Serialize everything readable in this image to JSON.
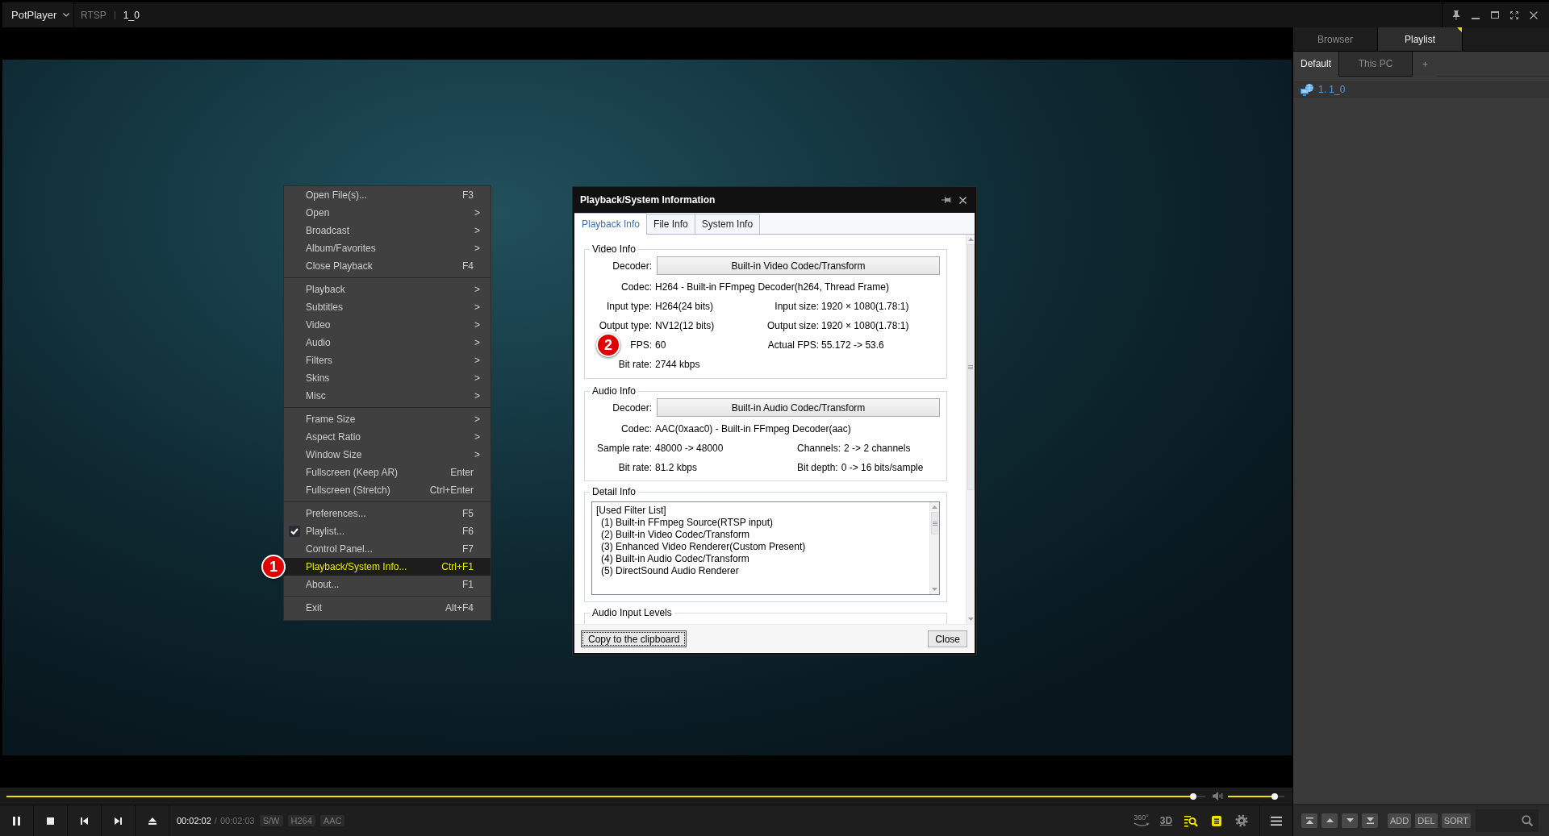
{
  "title_bar": {
    "app_name": "PotPlayer",
    "source": "RTSP",
    "title": "1_0"
  },
  "context_menu": {
    "groups": [
      [
        {
          "label": "Open File(s)...",
          "shortcut": "F3",
          "checked": false,
          "selected": false
        },
        {
          "label": "Open",
          "submenu": ">",
          "checked": false,
          "selected": false
        },
        {
          "label": "Broadcast",
          "submenu": ">",
          "checked": false,
          "selected": false
        },
        {
          "label": "Album/Favorites",
          "submenu": ">",
          "checked": false,
          "selected": false
        },
        {
          "label": "Close Playback",
          "shortcut": "F4",
          "checked": false,
          "selected": false
        }
      ],
      [
        {
          "label": "Playback",
          "submenu": ">",
          "checked": false,
          "selected": false
        },
        {
          "label": "Subtitles",
          "submenu": ">",
          "checked": false,
          "selected": false
        },
        {
          "label": "Video",
          "submenu": ">",
          "checked": false,
          "selected": false
        },
        {
          "label": "Audio",
          "submenu": ">",
          "checked": false,
          "selected": false
        },
        {
          "label": "Filters",
          "submenu": ">",
          "checked": false,
          "selected": false
        },
        {
          "label": "Skins",
          "submenu": ">",
          "checked": false,
          "selected": false
        },
        {
          "label": "Misc",
          "submenu": ">",
          "checked": false,
          "selected": false
        }
      ],
      [
        {
          "label": "Frame Size",
          "submenu": ">",
          "checked": false,
          "selected": false
        },
        {
          "label": "Aspect Ratio",
          "submenu": ">",
          "checked": false,
          "selected": false
        },
        {
          "label": "Window Size",
          "submenu": ">",
          "checked": false,
          "selected": false
        },
        {
          "label": "Fullscreen (Keep AR)",
          "shortcut": "Enter",
          "checked": false,
          "selected": false
        },
        {
          "label": "Fullscreen (Stretch)",
          "shortcut": "Ctrl+Enter",
          "checked": false,
          "selected": false
        }
      ],
      [
        {
          "label": "Preferences...",
          "shortcut": "F5",
          "checked": false,
          "selected": false
        },
        {
          "label": "Playlist...",
          "shortcut": "F6",
          "checked": true,
          "selected": false
        },
        {
          "label": "Control Panel...",
          "shortcut": "F7",
          "checked": false,
          "selected": false
        },
        {
          "label": "Playback/System Info...",
          "shortcut": "Ctrl+F1",
          "checked": false,
          "selected": true,
          "marker": "1"
        },
        {
          "label": "About...",
          "shortcut": "F1",
          "checked": false,
          "selected": false
        }
      ],
      [
        {
          "label": "Exit",
          "shortcut": "Alt+F4",
          "checked": false,
          "selected": false
        }
      ]
    ]
  },
  "info_dialog": {
    "title": "Playback/System Information",
    "tabs": [
      {
        "label": "Playback Info",
        "selected": true
      },
      {
        "label": "File Info",
        "selected": false
      },
      {
        "label": "System Info",
        "selected": false
      }
    ],
    "sections": [
      {
        "kind": "video",
        "legend": "Video Info",
        "decoder": {
          "label": "Decoder:",
          "value": "Built-in Video Codec/Transform"
        },
        "rows": [
          [
            {
              "label": "Codec:",
              "value": "H264 - Built-in FFmpeg Decoder(h264, Thread Frame)"
            }
          ],
          [
            {
              "label": "Input type:",
              "value": "H264(24 bits)"
            },
            {
              "label": "Input size:",
              "value": "1920 × 1080(1.78:1)"
            }
          ],
          [
            {
              "label": "Output type:",
              "value": "NV12(12 bits)"
            },
            {
              "label": "Output size:",
              "value": "1920 × 1080(1.78:1)"
            }
          ],
          [
            {
              "label": "FPS:",
              "value": "60",
              "marker": "2"
            },
            {
              "label": "Actual FPS:",
              "value": "55.172 -> 53.6"
            }
          ],
          [
            {
              "label": "Bit rate:",
              "value": "2744 kbps"
            }
          ]
        ]
      },
      {
        "kind": "audio",
        "legend": "Audio Info",
        "decoder": {
          "label": "Decoder:",
          "value": "Built-in Audio Codec/Transform"
        },
        "rows": [
          [
            {
              "label": "Codec:",
              "value": "AAC(0xaac0) - Built-in FFmpeg Decoder(aac)"
            }
          ],
          [
            {
              "label": "Sample rate:",
              "value": "48000 -> 48000"
            },
            {
              "label": "Channels:",
              "value": "2 -> 2 channels"
            }
          ],
          [
            {
              "label": "Bit rate:",
              "value": "81.2 kbps"
            },
            {
              "label": "Bit depth:",
              "value": "0 -> 16 bits/sample"
            }
          ]
        ]
      },
      {
        "kind": "detail",
        "legend": "Detail Info",
        "lines": [
          {
            "text": "[Used Filter List]",
            "children": [
              {
                "text": "(1) Built-in FFmpeg Source(RTSP input)"
              },
              {
                "text": "(2) Built-in Video Codec/Transform"
              },
              {
                "text": "(3) Enhanced Video Renderer(Custom Present)"
              },
              {
                "text": "(4) Built-in Audio Codec/Transform"
              },
              {
                "text": "(5) DirectSound Audio Renderer"
              }
            ]
          }
        ]
      },
      {
        "kind": "levels",
        "legend": "Audio Input Levels"
      }
    ],
    "buttons": [
      {
        "label": "Copy to the clipboard",
        "focused": true
      },
      {
        "label": "Close",
        "focused": false
      }
    ]
  },
  "playlist_panel": {
    "tabs": [
      {
        "label": "Browser",
        "selected": false
      },
      {
        "label": "Playlist",
        "selected": true
      }
    ],
    "lists": [
      {
        "label": "Default",
        "selected": true
      },
      {
        "label": "This PC",
        "selected": false
      }
    ],
    "new_list": "+",
    "items": [
      {
        "label": "1. 1_0",
        "playing": true
      }
    ],
    "actions": [
      "ADD",
      "DEL",
      "SORT"
    ]
  },
  "player": {
    "seek": {
      "level": 0.99
    },
    "volume": {
      "level": 0.83
    },
    "time": {
      "current": "00:02:02",
      "separator": "/",
      "total": "00:02:03"
    },
    "tags": [
      "S/W",
      "H264",
      "AAC"
    ],
    "tools": [
      {
        "kind": "panorama",
        "label": "360°",
        "on": false
      },
      {
        "kind": "stereo",
        "label": "3D",
        "on": false
      },
      {
        "kind": "search",
        "on": true
      },
      {
        "kind": "document",
        "on": true
      }
    ]
  }
}
